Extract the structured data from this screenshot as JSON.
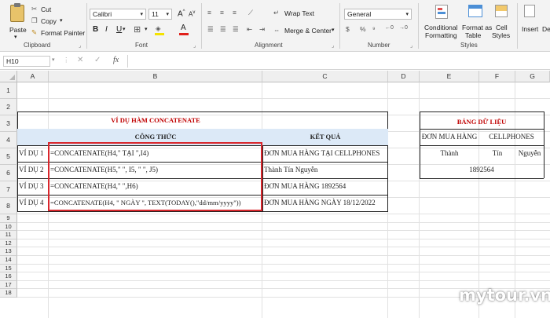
{
  "clipboard": {
    "paste": "Paste",
    "cut": "Cut",
    "copy": "Copy",
    "format_painter": "Format Painter",
    "label": "Clipboard"
  },
  "font": {
    "name": "Calibri",
    "size": "11",
    "label": "Font"
  },
  "alignment": {
    "wrap_text": "Wrap Text",
    "merge_center": "Merge & Center",
    "label": "Alignment"
  },
  "number": {
    "format": "General",
    "label": "Number"
  },
  "styles": {
    "conditional_1": "Conditional",
    "conditional_2": "Formatting",
    "format_as_1": "Format as",
    "format_as_2": "Table",
    "cell_styles_1": "Cell",
    "cell_styles_2": "Styles",
    "label": "Styles"
  },
  "cells_group": {
    "insert": "Insert",
    "delete": "De"
  },
  "formula_bar": {
    "name_box": "H10",
    "fx": "fx",
    "content": ""
  },
  "columns": [
    "A",
    "B",
    "C",
    "D",
    "E",
    "F",
    "G"
  ],
  "rows": [
    "1",
    "2",
    "3",
    "4",
    "5",
    "6",
    "7",
    "8",
    "9",
    "10",
    "11",
    "12",
    "13",
    "14",
    "15",
    "16",
    "17",
    "18"
  ],
  "sheet": {
    "title": "VÍ DỤ HÀM CONCATENATE",
    "header_formula": "CÔNG THỨC",
    "header_result": "KẾT QUẢ",
    "rows": [
      {
        "label": "VÍ DỤ 1",
        "formula": "=CONCATENATE(H4,\" TẠI \",I4)",
        "result": "ĐƠN MUA HÀNG TẠI CELLPHONES"
      },
      {
        "label": "VÍ DỤ 2",
        "formula": "=CONCATENATE(H5,\" \", I5, \" \", J5)",
        "result": "Thành Tín Nguyễn"
      },
      {
        "label": "VÍ DỤ 3",
        "formula": "=CONCATENATE(H4,\" \",H6)",
        "result": "ĐƠN MUA HÀNG 1892564"
      },
      {
        "label": "VÍ DỤ 4",
        "formula": "=CONCATENATE(H4, \" NGÀY \", TEXT(TODAY(),\"dd/mm/yyyy\"))",
        "result": "ĐƠN MUA HÀNG NGÀY 18/12/2022"
      }
    ],
    "data_title": "BẢNG DỮ LIỆU",
    "data_r4_a": "ĐƠN MUA HÀNG",
    "data_r4_b": "CELLPHONES",
    "data_r5_a": "Thành",
    "data_r5_b": "Tín",
    "data_r5_c": "Nguyễn",
    "data_r6": "1892564"
  },
  "watermark": "mytour.vn",
  "colors": {
    "accent_red": "#c00000",
    "highlight_box": "#d9262c",
    "header_fill": "#dce9f7"
  }
}
